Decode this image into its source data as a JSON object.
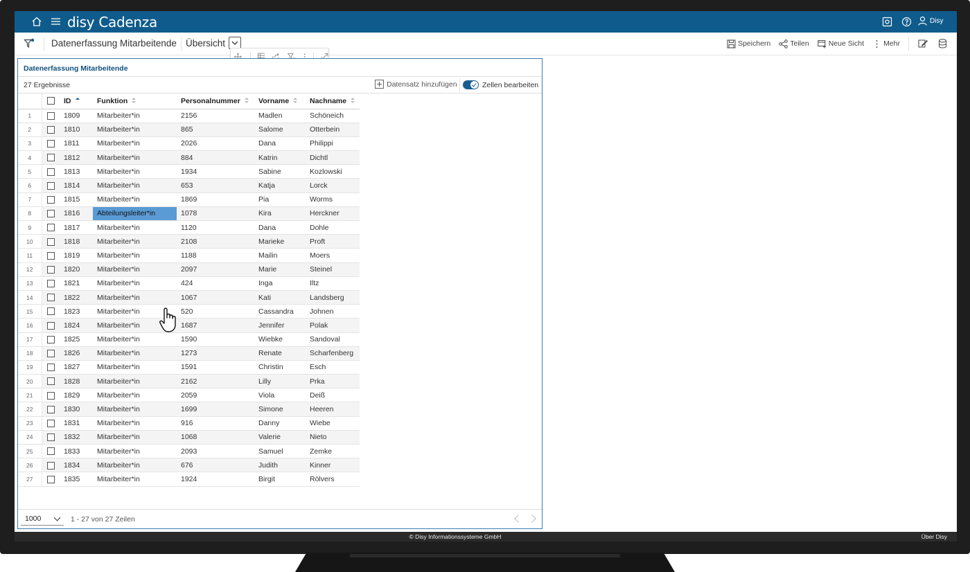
{
  "app": {
    "brand": "disy Cadenza",
    "user": "Disy"
  },
  "toolbar": {
    "workspace_title": "Datenerfassung Mitarbeitende",
    "view_title": "Übersicht",
    "save_label": "Speichern",
    "share_label": "Teilen",
    "new_view_label": "Neue Sicht",
    "more_label": "Mehr"
  },
  "panel": {
    "title": "Datenerfassung Mitarbeitende",
    "results": "27 Ergebnisse",
    "add_record_label": "Datensatz hinzufügen",
    "edit_cells_label": "Zellen bearbeiten",
    "edit_cells_on": true
  },
  "table": {
    "columns": [
      "ID",
      "Funktion",
      "Personalnummer",
      "Vorname",
      "Nachname"
    ],
    "sorted_column": "ID",
    "highlighted_cell": {
      "row": 8,
      "column": "Funktion"
    },
    "rows": [
      [
        "1",
        "1809",
        "Mitarbeiter*in",
        "2156",
        "Madlen",
        "Schöneich"
      ],
      [
        "2",
        "1810",
        "Mitarbeiter*in",
        "865",
        "Salome",
        "Otterbein"
      ],
      [
        "3",
        "1811",
        "Mitarbeiter*in",
        "2026",
        "Dana",
        "Philippi"
      ],
      [
        "4",
        "1812",
        "Mitarbeiter*in",
        "884",
        "Katrin",
        "Dichtl"
      ],
      [
        "5",
        "1813",
        "Mitarbeiter*in",
        "1934",
        "Sabine",
        "Kozlowski"
      ],
      [
        "6",
        "1814",
        "Mitarbeiter*in",
        "653",
        "Katja",
        "Lorck"
      ],
      [
        "7",
        "1815",
        "Mitarbeiter*in",
        "1869",
        "Pia",
        "Worms"
      ],
      [
        "8",
        "1816",
        "Abteilungsleiter*in",
        "1078",
        "Kira",
        "Herckner"
      ],
      [
        "9",
        "1817",
        "Mitarbeiter*in",
        "1120",
        "Dana",
        "Dohle"
      ],
      [
        "10",
        "1818",
        "Mitarbeiter*in",
        "2108",
        "Marieke",
        "Proft"
      ],
      [
        "11",
        "1819",
        "Mitarbeiter*in",
        "1188",
        "Mailin",
        "Moers"
      ],
      [
        "12",
        "1820",
        "Mitarbeiter*in",
        "2097",
        "Marie",
        "Steinel"
      ],
      [
        "13",
        "1821",
        "Mitarbeiter*in",
        "424",
        "Inga",
        "Iltz"
      ],
      [
        "14",
        "1822",
        "Mitarbeiter*in",
        "1067",
        "Kati",
        "Landsberg"
      ],
      [
        "15",
        "1823",
        "Mitarbeiter*in",
        "520",
        "Cassandra",
        "Johnen"
      ],
      [
        "16",
        "1824",
        "Mitarbeiter*in",
        "1687",
        "Jennifer",
        "Polak"
      ],
      [
        "17",
        "1825",
        "Mitarbeiter*in",
        "1590",
        "Wiebke",
        "Sandoval"
      ],
      [
        "18",
        "1826",
        "Mitarbeiter*in",
        "1273",
        "Renate",
        "Scharfenberg"
      ],
      [
        "19",
        "1827",
        "Mitarbeiter*in",
        "1591",
        "Christin",
        "Esch"
      ],
      [
        "20",
        "1828",
        "Mitarbeiter*in",
        "2162",
        "Lilly",
        "Prka"
      ],
      [
        "21",
        "1829",
        "Mitarbeiter*in",
        "2059",
        "Viola",
        "Deiß"
      ],
      [
        "22",
        "1830",
        "Mitarbeiter*in",
        "1699",
        "Simone",
        "Heeren"
      ],
      [
        "23",
        "1831",
        "Mitarbeiter*in",
        "916",
        "Danny",
        "Wiebe"
      ],
      [
        "24",
        "1832",
        "Mitarbeiter*in",
        "1068",
        "Valerie",
        "Nieto"
      ],
      [
        "25",
        "1833",
        "Mitarbeiter*in",
        "2093",
        "Samuel",
        "Zemke"
      ],
      [
        "26",
        "1834",
        "Mitarbeiter*in",
        "676",
        "Judith",
        "Kinner"
      ],
      [
        "27",
        "1835",
        "Mitarbeiter*in",
        "1924",
        "Birgit",
        "Rölvers"
      ]
    ]
  },
  "pagination": {
    "page_size": "1000",
    "range_text": "1 - 27 von 27 Zeilen"
  },
  "statusbar": {
    "copyright": "© Disy Informationssysteme GmbH",
    "about": "Über Disy"
  },
  "colors": {
    "header_blue": "#0f5c8c",
    "panel_border": "#3d7ab0",
    "highlight": "#5b9bd5"
  },
  "icons": [
    "home-icon",
    "menu-icon",
    "screenshot-icon",
    "help-icon",
    "user-icon",
    "filter-icon",
    "chevron-down-icon",
    "save-icon",
    "share-icon",
    "new-view-icon",
    "more-icon",
    "edit-icon",
    "database-icon",
    "move-icon",
    "table-icon",
    "export-icon",
    "filter-small-icon",
    "dots-icon",
    "expand-icon",
    "hand-cursor-icon"
  ]
}
